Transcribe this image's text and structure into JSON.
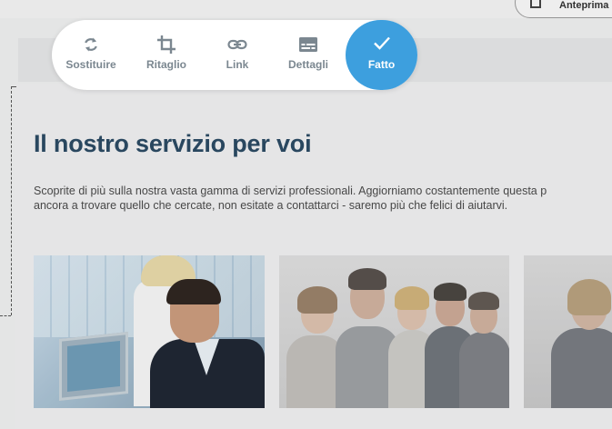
{
  "toolbar": {
    "replace_label": "Sostituire",
    "crop_label": "Ritaglio",
    "link_label": "Link",
    "details_label": "Dettagli",
    "done_label": "Fatto",
    "icons": {
      "replace": "refresh-icon",
      "crop": "crop-icon",
      "link": "link-icon",
      "details": "details-icon",
      "done": "checkmark-icon"
    }
  },
  "topbar": {
    "preview_label": "Anteprima",
    "preview_icon": "monitor-icon"
  },
  "section": {
    "heading": "Il nostro servizio per voi",
    "description_line1": "Scoprite di più sulla nostra vasta gamma di servizi professionali. Aggiorniamo costantemente questa p",
    "description_line2": "ancora a trovare quello che cercate, non esitate a contattarci - saremo più che felici di aiutarvi."
  },
  "colors": {
    "accent": "#3d9fde",
    "heading": "#2b4a63",
    "toolbar_label": "#7b8790"
  }
}
